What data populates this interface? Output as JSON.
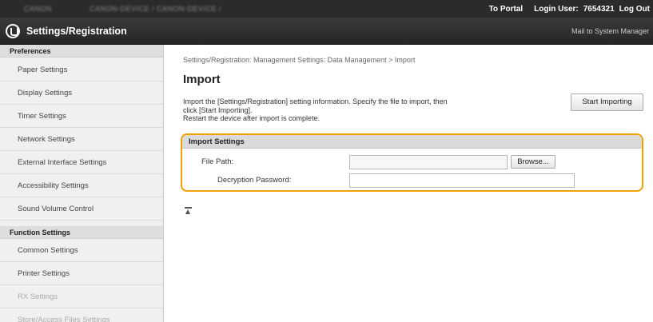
{
  "topbar": {
    "blurred_left": "CANON",
    "blurred_path": "CANON-DEVICE / CANON-DEVICE /",
    "portal_label": "To Portal",
    "login_label": "Login User:",
    "login_user": "7654321",
    "logout_label": "Log Out"
  },
  "header": {
    "title": "Settings/Registration",
    "mail_link": "Mail to System Manager"
  },
  "sidebar": {
    "preferences_header": "Preferences",
    "preferences_items": [
      {
        "label": "Paper Settings"
      },
      {
        "label": "Display Settings"
      },
      {
        "label": "Timer Settings"
      },
      {
        "label": "Network Settings"
      },
      {
        "label": "External Interface Settings"
      },
      {
        "label": "Accessibility Settings"
      },
      {
        "label": "Sound Volume Control"
      }
    ],
    "function_header": "Function Settings",
    "function_items": [
      {
        "label": "Common Settings"
      },
      {
        "label": "Printer Settings"
      },
      {
        "label": "RX Settings"
      },
      {
        "label": "Store/Access Files Settings"
      }
    ]
  },
  "main": {
    "breadcrumb": "Settings/Registration: Management Settings: Data Management > Import",
    "title": "Import",
    "description_lines": [
      "Import the [Settings/Registration] setting information. Specify the file to import, then",
      "click [Start Importing].",
      "Restart the device after import is complete."
    ],
    "start_button": "Start Importing",
    "import_settings": {
      "header": "Import Settings",
      "file_path_label": "File Path:",
      "file_path_value": "",
      "browse_button": "Browse...",
      "password_label": "Decryption Password:",
      "password_value": ""
    }
  },
  "colors": {
    "highlight": "#f2a100",
    "topbar": "#2b2b2b",
    "header": "#303030",
    "sidebar_bg": "#f0f0f0"
  }
}
